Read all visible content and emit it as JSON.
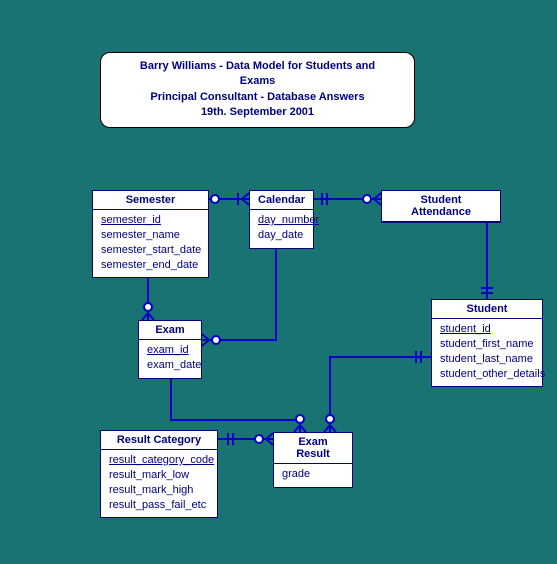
{
  "title": {
    "line1": "Barry Williams - Data Model for Students and Exams",
    "line2": "Principal Consultant - Database Answers",
    "line3": "19th. September 2001"
  },
  "entities": {
    "semester": {
      "name": "Semester",
      "pk": "semester_id",
      "a1": "semester_name",
      "a2": "semester_start_date",
      "a3": "semester_end_date"
    },
    "calendar": {
      "name": "Calendar",
      "pk": "day_number",
      "a1": "day_date"
    },
    "student_attendance": {
      "name": "Student Attendance"
    },
    "exam": {
      "name": "Exam",
      "pk": "exam_id",
      "a1": "exam_date"
    },
    "student": {
      "name": "Student",
      "pk": "student_id",
      "a1": "student_first_name",
      "a2": "student_last_name",
      "a3": "student_other_details"
    },
    "result_category": {
      "name": "Result Category",
      "pk": "result_category_code",
      "a1": "result_mark_low",
      "a2": "result_mark_high",
      "a3": "result_pass_fail_etc"
    },
    "exam_result": {
      "name": "Exam Result",
      "a1": "grade"
    }
  }
}
